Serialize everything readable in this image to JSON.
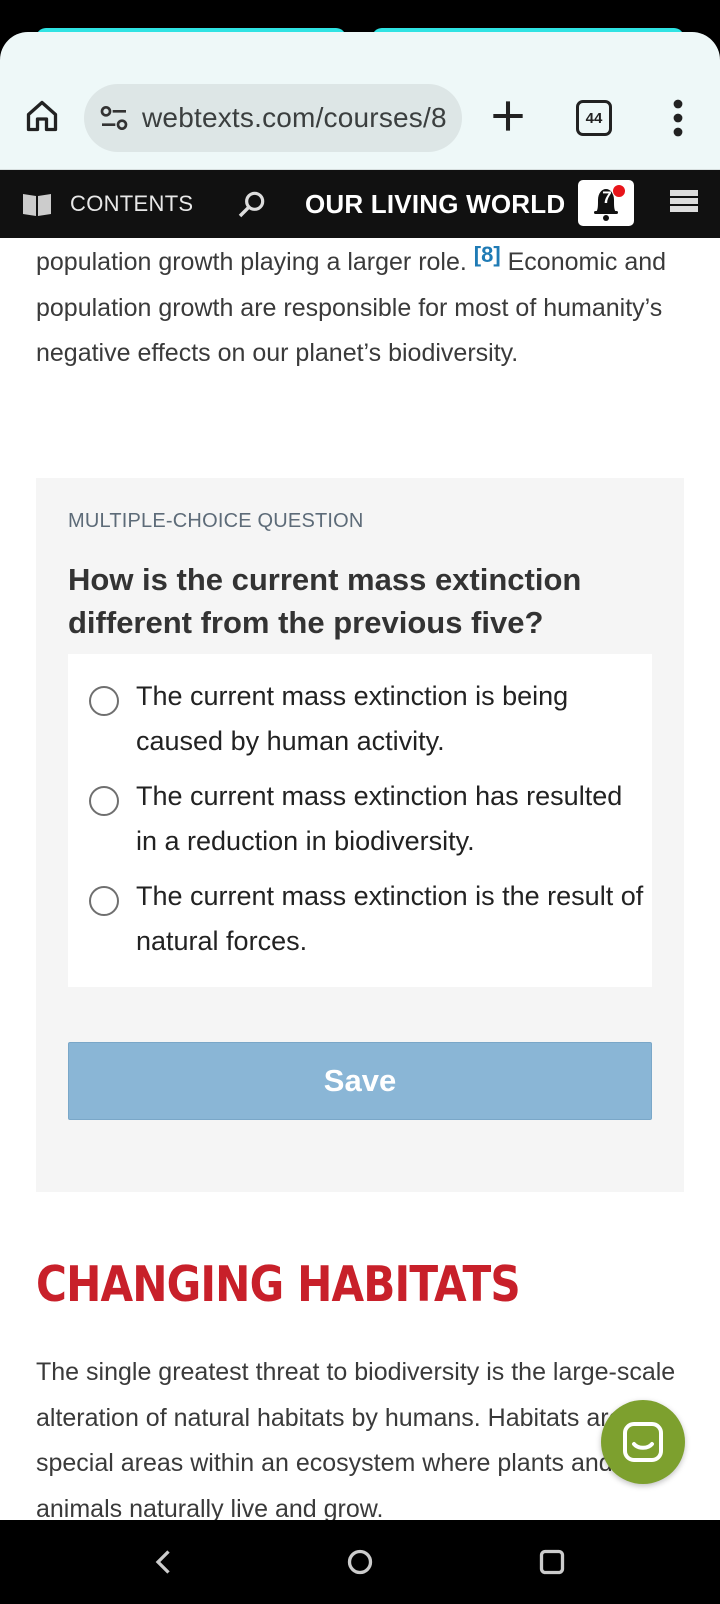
{
  "browser": {
    "url": "webtexts.com/courses/8",
    "tab_count": "44"
  },
  "site_nav": {
    "contents_label": "CONTENTS",
    "title": "OUR LIVING WORLD",
    "notification_count": "7"
  },
  "article": {
    "intro_text_before_note": "population growth playing a larger role.",
    "footnote": "[8]",
    "intro_text_after_note": " Economic and population growth are responsible for most of humanity’s negative effects on our planet’s biodiversity.",
    "section_heading": "CHANGING HABITATS",
    "section_text": "The single greatest threat to biodiversity is the large-scale alteration of natural habitats by humans. Habitats are the special areas within an ecosystem where plants and animals naturally live and grow."
  },
  "quiz": {
    "kicker": "MULTIPLE-CHOICE QUESTION",
    "question": "How is the current mass extinction different from the previous five?",
    "options": [
      {
        "label": "The current mass extinction is being caused by human activity.",
        "selected": false
      },
      {
        "label": "The current mass extinction has resulted in a reduction in biodiversity.",
        "selected": false
      },
      {
        "label": "The current mass extinction is the result of natural forces.",
        "selected": false
      }
    ],
    "save_label": "Save"
  },
  "icons": {
    "home": "home-icon",
    "site_info": "tune-icon",
    "new_tab": "plus-icon",
    "tabs": "tab-count-icon",
    "overflow": "more-vert-icon",
    "contents": "book-icon",
    "search": "search-icon",
    "notifications": "bell-icon",
    "menu": "hamburger-icon",
    "chat": "chat-icon",
    "sys_back": "back-icon",
    "sys_home": "home-circle-icon",
    "sys_recent": "recents-icon"
  },
  "colors": {
    "brand_red": "#c8202a",
    "link_blue": "#1f7bb5",
    "save_button": "#8ab6d6",
    "chat_button": "#7da02e",
    "notification_dot": "#e8141a"
  }
}
